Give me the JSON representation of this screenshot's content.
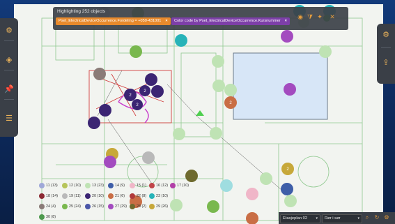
{
  "filter": {
    "title": "Highlighting 252 objects",
    "chip_filter": "Pset_ElectricalDeviceOccurrence.Fordeling = +050-431001",
    "chip_color": "Color code by Pset_ElectricalDeviceOccurrence.Kursnummer",
    "chip_close": "×",
    "colors": {
      "filter_chip": "#e88a2c",
      "color_chip": "#7d3fa8"
    }
  },
  "plan_labels": [
    "2",
    "2",
    "2",
    "2",
    "2",
    "2",
    "2",
    "2",
    "2"
  ],
  "legend": [
    {
      "label": "11 (13)",
      "color": "#9fa8d8"
    },
    {
      "label": "12 (10)",
      "color": "#b6c45a"
    },
    {
      "label": "13 (23)",
      "color": "#bfe3b4"
    },
    {
      "label": "14 (9)",
      "color": "#3e5ea8"
    },
    {
      "label": "15 (1)",
      "color": "#f0b6c8"
    },
    {
      "label": "16 (12)",
      "color": "#c0454a"
    },
    {
      "label": "17 (10)",
      "color": "#b23fa8"
    },
    {
      "label": "18 (14)",
      "color": "#8c2a33"
    },
    {
      "label": "19 (11)",
      "color": "#b9b9b9"
    },
    {
      "label": "20 (10)",
      "color": "#3b2573"
    },
    {
      "label": "21 (6)",
      "color": "#c96e45"
    },
    {
      "label": "22 (8)",
      "color": "#b03a3a"
    },
    {
      "label": "23 (10)",
      "color": "#27b3b8"
    },
    {
      "label": "24 (4)",
      "color": "#8a7b77"
    },
    {
      "label": "25 (24)",
      "color": "#79b84e"
    },
    {
      "label": "26 (15)",
      "color": "#4a56a8"
    },
    {
      "label": "27 (29)",
      "color": "#a34bbf"
    },
    {
      "label": "28 (2)",
      "color": "#6e6a2e"
    },
    {
      "label": "29 (26)",
      "color": "#c7a83a"
    },
    {
      "label": "30 (8)",
      "color": "#4e9a4e"
    }
  ],
  "bottom": {
    "floor_select": "Etasjeplan 02",
    "type_select": "Rør i sør"
  },
  "icons": {
    "left_panel": [
      "settings-icon",
      "cube-icon",
      "pin-icon",
      "list-icon"
    ],
    "right_panel": [
      "gear-icon",
      "export-icon"
    ]
  }
}
